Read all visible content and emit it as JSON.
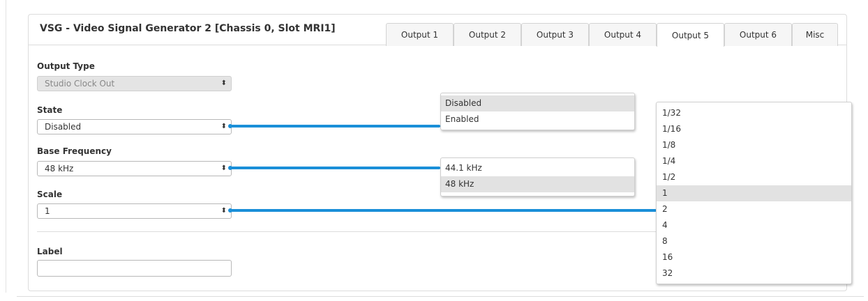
{
  "panel": {
    "title": "VSG - Video Signal Generator 2 [Chassis 0, Slot MRI1]"
  },
  "tabs": [
    {
      "label": "Output 1",
      "active": false
    },
    {
      "label": "Output 2",
      "active": false
    },
    {
      "label": "Output 3",
      "active": false
    },
    {
      "label": "Output 4",
      "active": false
    },
    {
      "label": "Output 5",
      "active": true
    },
    {
      "label": "Output 6",
      "active": false
    },
    {
      "label": "Misc",
      "active": false
    }
  ],
  "form": {
    "output_type": {
      "label": "Output Type",
      "value": "Studio Clock Out",
      "disabled": true
    },
    "state": {
      "label": "State",
      "value": "Disabled",
      "options": [
        "Disabled",
        "Enabled"
      ],
      "highlighted": "Disabled"
    },
    "base_frequency": {
      "label": "Base Frequency",
      "value": "48 kHz",
      "options": [
        "44.1 kHz",
        "48 kHz"
      ],
      "highlighted": "48 kHz"
    },
    "scale": {
      "label": "Scale",
      "value": "1",
      "options": [
        "1/32",
        "1/16",
        "1/8",
        "1/4",
        "1/2",
        "1",
        "2",
        "4",
        "8",
        "16",
        "32"
      ],
      "highlighted": "1"
    },
    "label_field": {
      "label": "Label",
      "value": ""
    }
  },
  "icons": {
    "select_arrows": "⬍"
  },
  "colors": {
    "accent": "#1a8fd8",
    "highlight": "#e2e2e2",
    "disabled_bg": "#e4e4e4"
  }
}
